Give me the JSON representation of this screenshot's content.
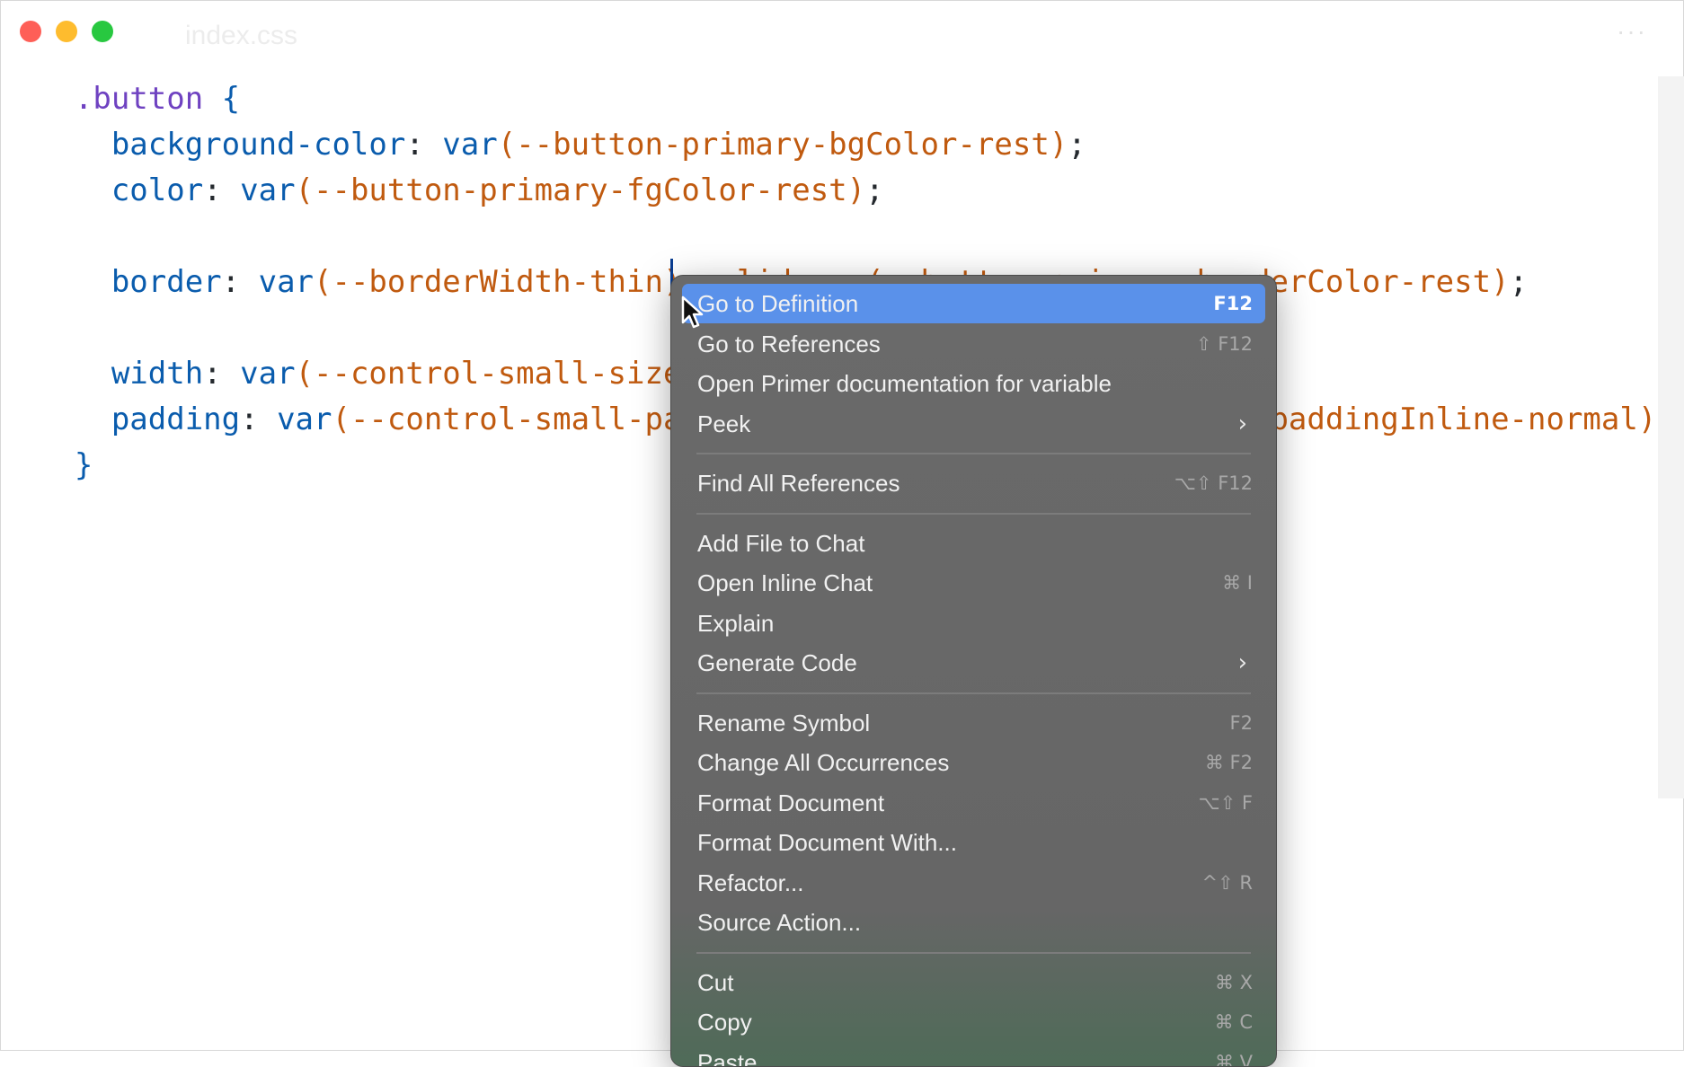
{
  "window": {
    "title": "index.css",
    "more": "···"
  },
  "editor": {
    "lines": [
      [
        {
          "c": "sel",
          "t": "    .button "
        },
        {
          "c": "prop",
          "t": "{"
        }
      ],
      [
        {
          "c": "prop",
          "t": "      background-color"
        },
        {
          "c": "pun",
          "t": ": "
        },
        {
          "c": "fn",
          "t": "var"
        },
        {
          "c": "var",
          "t": "(--button-primary-bgColor-rest)"
        },
        {
          "c": "pun",
          "t": ";"
        }
      ],
      [
        {
          "c": "prop",
          "t": "      color"
        },
        {
          "c": "pun",
          "t": ": "
        },
        {
          "c": "fn",
          "t": "var"
        },
        {
          "c": "var",
          "t": "(--button-primary-fgColor-rest)"
        },
        {
          "c": "pun",
          "t": ";"
        }
      ],
      [],
      [
        {
          "c": "prop",
          "t": "      border"
        },
        {
          "c": "pun",
          "t": ": "
        },
        {
          "c": "fn",
          "t": "var"
        },
        {
          "c": "var",
          "t": "(--borderWidth-thin) solid var(--button-primary-borderColor-rest)"
        },
        {
          "c": "pun",
          "t": ";"
        }
      ],
      [],
      [
        {
          "c": "prop",
          "t": "      width"
        },
        {
          "c": "pun",
          "t": ": "
        },
        {
          "c": "fn",
          "t": "var"
        },
        {
          "c": "var",
          "t": "(--control-small-size)"
        },
        {
          "c": "pun",
          "t": ";"
        }
      ],
      [
        {
          "c": "prop",
          "t": "      padding"
        },
        {
          "c": "pun",
          "t": ": "
        },
        {
          "c": "fn",
          "t": "var"
        },
        {
          "c": "var",
          "t": "(--control-small-paddingBlock) var(--control-small-paddingInline-normal)"
        },
        {
          "c": "pun",
          "t": ";"
        }
      ],
      [
        {
          "c": "prop",
          "t": "    }"
        }
      ]
    ]
  },
  "context_menu": {
    "groups": [
      [
        {
          "label": "Go to Definition",
          "shortcut": "F12",
          "highlighted": true
        },
        {
          "label": "Go to References",
          "shortcut": "⇧ F12"
        },
        {
          "label": "Open Primer documentation for variable",
          "shortcut": ""
        },
        {
          "label": "Peek",
          "submenu": true
        }
      ],
      [
        {
          "label": "Find All References",
          "shortcut": "⌥⇧ F12"
        }
      ],
      [
        {
          "label": "Add File to Chat",
          "shortcut": ""
        },
        {
          "label": "Open Inline Chat",
          "shortcut": "⌘ I"
        },
        {
          "label": "Explain",
          "shortcut": ""
        },
        {
          "label": "Generate Code",
          "submenu": true
        }
      ],
      [
        {
          "label": "Rename Symbol",
          "shortcut": "F2"
        },
        {
          "label": "Change All Occurrences",
          "shortcut": "⌘ F2"
        },
        {
          "label": "Format Document",
          "shortcut": "⌥⇧ F"
        },
        {
          "label": "Format Document With...",
          "shortcut": ""
        },
        {
          "label": "Refactor...",
          "shortcut": "^⇧ R"
        },
        {
          "label": "Source Action...",
          "shortcut": ""
        }
      ],
      [
        {
          "label": "Cut",
          "shortcut": "⌘ X"
        },
        {
          "label": "Copy",
          "shortcut": "⌘ C"
        },
        {
          "label": "Paste",
          "shortcut": "⌘ V"
        }
      ]
    ],
    "submenu_glyph": "›"
  },
  "colors": {
    "highlight": "#5a91ea",
    "menu_bg": "#666666"
  }
}
